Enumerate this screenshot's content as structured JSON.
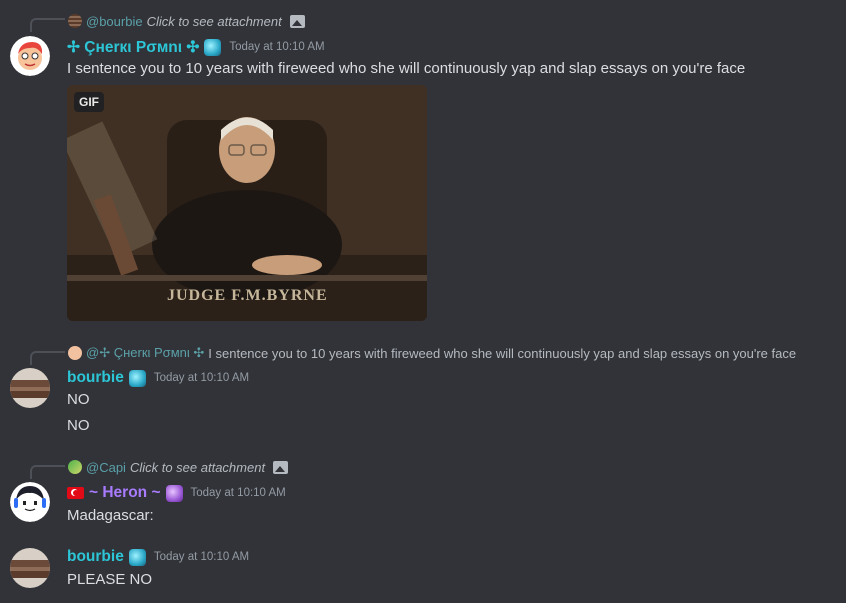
{
  "messages": [
    {
      "reply": {
        "name": "@bourbie",
        "text": "Click to see attachment"
      },
      "author": "✢ Çнerкι Pσмnι ✣",
      "author_color": "#2cc6d6",
      "timestamp": "Today at 10:10 AM",
      "content": "I sentence you to 10 years with fireweed who she will continuously yap and slap essays on you're face",
      "gif": {
        "tag": "GIF",
        "plate_text": "JUDGE F.M.BYRNE"
      }
    },
    {
      "reply": {
        "name": "@✢ Çнerкι Pσмnι ✣",
        "text": "I sentence you to 10 years with fireweed who she will continuously yap and slap essays on you're face"
      },
      "author": "bourbie",
      "author_color": "#2cc6d6",
      "timestamp": "Today at 10:10 AM",
      "lines": [
        "NO",
        "NO"
      ]
    },
    {
      "reply": {
        "name": "@Capi",
        "text": "Click to see attachment"
      },
      "author": "~ Heron ~",
      "author_color": "#a97bff",
      "timestamp": "Today at 10:10 AM",
      "content": "Madagascar:"
    },
    {
      "author": "bourbie",
      "author_color": "#2cc6d6",
      "timestamp": "Today at 10:10 AM",
      "content": "PLEASE NO"
    }
  ],
  "icons": {
    "attachment": "image-icon",
    "badge": "badge-icon",
    "flag": "turkey-flag-icon"
  }
}
